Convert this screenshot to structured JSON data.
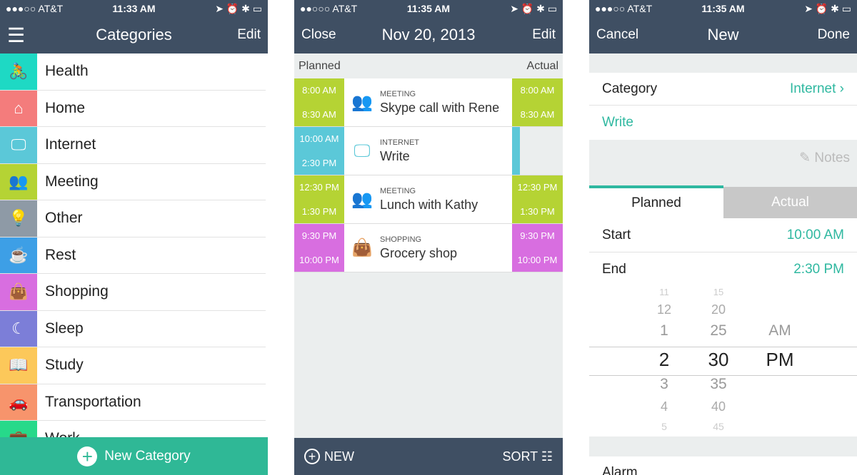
{
  "screen1": {
    "status": {
      "carrier": "●●●○○ AT&T",
      "time": "11:33 AM",
      "icons": "➤ ⏰ ✱ ▭"
    },
    "nav": {
      "menu_icon": "hamburger-icon",
      "title": "Categories",
      "edit": "Edit"
    },
    "categories": [
      {
        "label": "Health",
        "icon": "bicycle-icon",
        "glyph": "🚴",
        "color": "#1ed9c4"
      },
      {
        "label": "Home",
        "icon": "house-icon",
        "glyph": "⌂",
        "color": "#f47c7c"
      },
      {
        "label": "Internet",
        "icon": "monitor-icon",
        "glyph": "🖵",
        "color": "#5bc8d8"
      },
      {
        "label": "Meeting",
        "icon": "people-icon",
        "glyph": "👥",
        "color": "#b5d334"
      },
      {
        "label": "Other",
        "icon": "lightbulb-icon",
        "glyph": "💡",
        "color": "#8e9aa6"
      },
      {
        "label": "Rest",
        "icon": "coffee-icon",
        "glyph": "☕",
        "color": "#3d9fe6"
      },
      {
        "label": "Shopping",
        "icon": "bag-icon",
        "glyph": "👜",
        "color": "#d86ee0"
      },
      {
        "label": "Sleep",
        "icon": "moon-icon",
        "glyph": "☾",
        "color": "#7c7ed8"
      },
      {
        "label": "Study",
        "icon": "book-icon",
        "glyph": "📖",
        "color": "#fcc85a"
      },
      {
        "label": "Transportation",
        "icon": "car-icon",
        "glyph": "🚗",
        "color": "#f7946c"
      },
      {
        "label": "Work",
        "icon": "briefcase-icon",
        "glyph": "💼",
        "color": "#27d98a"
      }
    ],
    "new_category": "New Category"
  },
  "screen2": {
    "status": {
      "carrier": "●●○○○ AT&T",
      "time": "11:35 AM",
      "icons": "➤ ⏰ ✱ ▭"
    },
    "nav": {
      "close": "Close",
      "title": "Nov 20, 2013",
      "edit": "Edit"
    },
    "planned": "Planned",
    "actual": "Actual",
    "entries": [
      {
        "category": "MEETING",
        "name": "Skype call with Rene",
        "color": "#b5d334",
        "planned_start": "8:00 AM",
        "planned_end": "8:30 AM",
        "actual_start": "8:00 AM",
        "actual_end": "8:30 AM",
        "glyph": "👥"
      },
      {
        "category": "INTERNET",
        "name": "Write",
        "color": "#5bc8d8",
        "planned_start": "10:00 AM",
        "planned_end": "2:30 PM",
        "actual_start": "",
        "actual_end": "",
        "glyph": "🖵"
      },
      {
        "category": "MEETING",
        "name": "Lunch with Kathy",
        "color": "#b5d334",
        "planned_start": "12:30 PM",
        "planned_end": "1:30 PM",
        "actual_start": "12:30 PM",
        "actual_end": "1:30 PM",
        "glyph": "👥"
      },
      {
        "category": "SHOPPING",
        "name": "Grocery shop",
        "color": "#d86ee0",
        "planned_start": "9:30 PM",
        "planned_end": "10:00 PM",
        "actual_start": "9:30 PM",
        "actual_end": "10:00 PM",
        "glyph": "👜"
      }
    ],
    "new": "NEW",
    "sort": "SORT"
  },
  "screen3": {
    "status": {
      "carrier": "●●●○○ AT&T",
      "time": "11:35 AM",
      "icons": "➤ ⏰ ✱ ▭"
    },
    "nav": {
      "cancel": "Cancel",
      "title": "New",
      "done": "Done"
    },
    "category_label": "Category",
    "category_value": "Internet",
    "name_value": "Write",
    "notes": "Notes",
    "tabs": [
      "Planned",
      "Actual"
    ],
    "start_label": "Start",
    "start_value": "10:00 AM",
    "end_label": "End",
    "end_value": "2:30 PM",
    "picker": {
      "hours": [
        "11",
        "12",
        "1",
        "2",
        "3",
        "4",
        "5"
      ],
      "minutes": [
        "15",
        "20",
        "25",
        "30",
        "35",
        "40",
        "45"
      ],
      "ampm": [
        "AM",
        "PM"
      ],
      "selected": {
        "hour": "2",
        "minute": "30",
        "ampm": "PM"
      }
    },
    "alarm_label": "Alarm",
    "accent": "#2fb8a0"
  }
}
